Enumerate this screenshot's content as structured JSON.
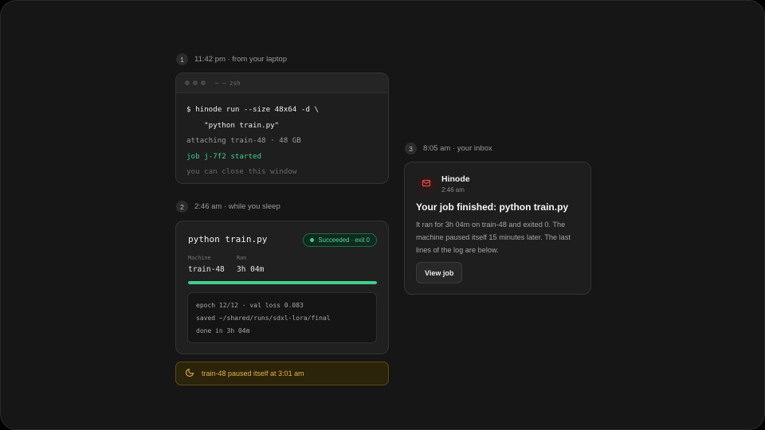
{
  "steps": [
    {
      "num": "1",
      "label": "11:42 pm · from your laptop"
    },
    {
      "num": "2",
      "label": "2:46 am · while you sleep"
    },
    {
      "num": "3",
      "label": "8:05 am · your inbox"
    }
  ],
  "terminal": {
    "title": "~ — zsh",
    "lines": [
      "$ hinode run --size 48x64 -d \\",
      "    \"python train.py\"",
      "attaching train-48 · 48 GB",
      "job j-7f2 started",
      "you can close this window"
    ]
  },
  "job": {
    "title": "python train.py",
    "status": "Succeeded · exit 0",
    "machine_label": "Machine",
    "machine_value": "train-48",
    "ran_label": "Ran",
    "ran_value": "3h 04m",
    "progress_percent": 100,
    "log": [
      "epoch 12/12 · val loss 0.083",
      "saved ~/shared/runs/sdxl-lora/final",
      "done in 3h 04m"
    ]
  },
  "notice": {
    "icon": "moon-icon",
    "text": "train-48 paused itself at 3:01 am"
  },
  "email": {
    "icon": "mail-icon",
    "sender": "Hinode",
    "time": "2:46 am",
    "subject": "Your job finished: python train.py",
    "body": "It ran for 3h 04m on train-48 and exited 0. The machine paused itself 15 minutes later. The last lines of the log are below.",
    "button": "View job"
  },
  "colors": {
    "success": "#3ecf8e",
    "warning": "#e3b341",
    "mail_accent": "#e5484d"
  }
}
